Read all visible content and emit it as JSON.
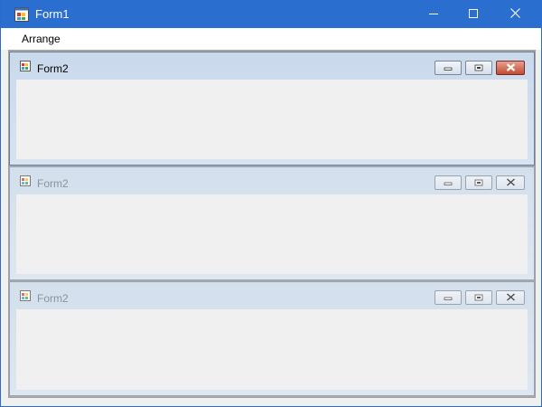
{
  "window": {
    "title": "Form1"
  },
  "menu": {
    "items": [
      {
        "label": "Arrange"
      }
    ]
  },
  "children": [
    {
      "title": "Form2",
      "state": "active"
    },
    {
      "title": "Form2",
      "state": "inactive"
    },
    {
      "title": "Form2",
      "state": "inactive"
    }
  ],
  "icons": {
    "app": "form-app-icon",
    "minimize": "minimize-icon",
    "maximize": "maximize-icon",
    "close": "close-icon",
    "restore": "restore-icon"
  },
  "colors": {
    "titlebar": "#2a6fcf",
    "mdi_background": "#ababab",
    "child_caption": "#c9d9ec",
    "client_area": "#f0f0f0",
    "close_active": "#c24a32"
  }
}
